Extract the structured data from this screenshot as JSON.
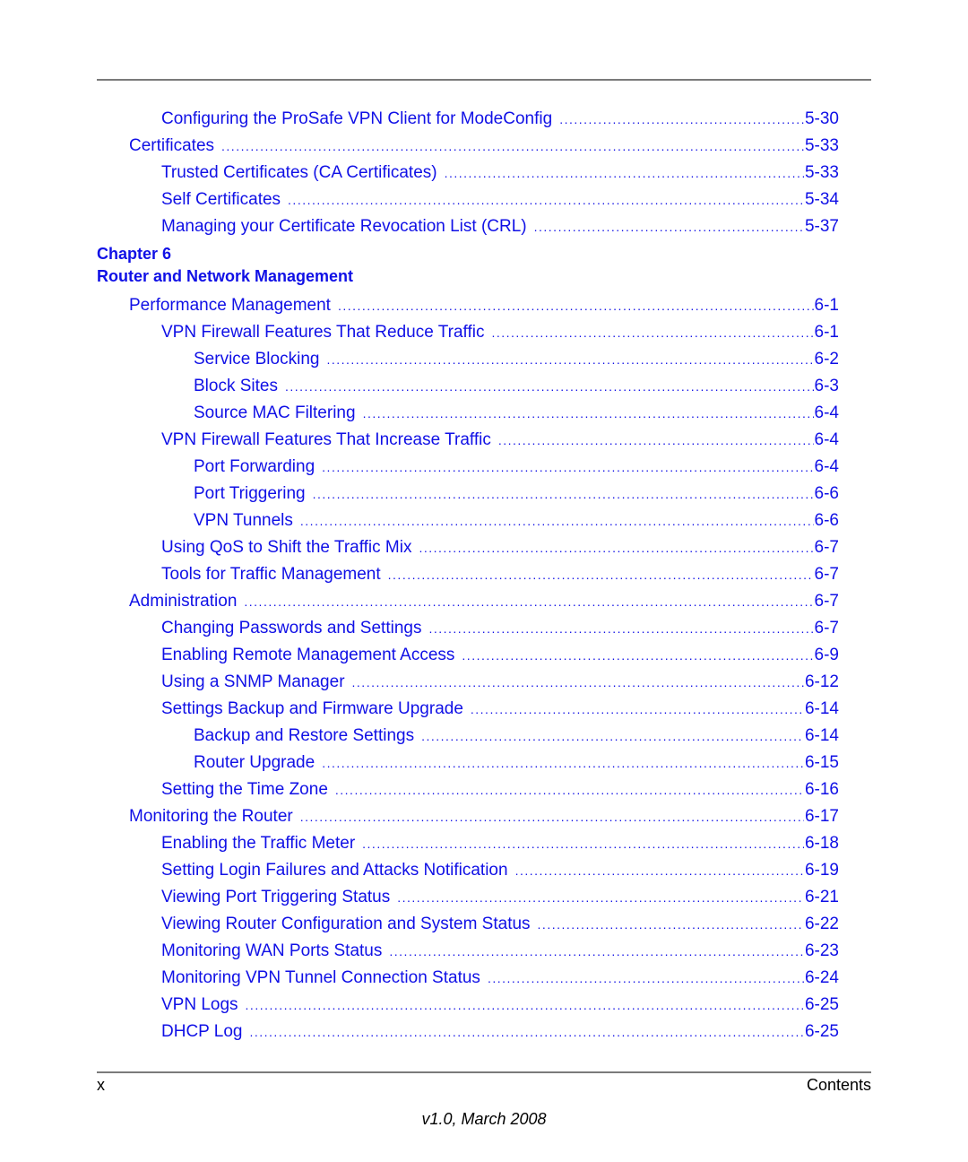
{
  "colors": {
    "link": "#1010e6",
    "rule": "#7a7a7a",
    "text": "#000000"
  },
  "toc_before": [
    {
      "level": 2,
      "title": "Configuring the ProSafe VPN Client for ModeConfig",
      "page": "5-30"
    },
    {
      "level": 1,
      "title": "Certificates",
      "page": "5-33"
    },
    {
      "level": 2,
      "title": "Trusted Certificates (CA Certificates)",
      "page": "5-33"
    },
    {
      "level": 2,
      "title": "Self Certificates",
      "page": "5-34"
    },
    {
      "level": 2,
      "title": "Managing your Certificate Revocation List (CRL)",
      "page": "5-37"
    }
  ],
  "chapter": {
    "number_label": "Chapter 6",
    "title": "Router and Network Management"
  },
  "toc_after": [
    {
      "level": 1,
      "title": "Performance Management",
      "page": "6-1"
    },
    {
      "level": 2,
      "title": "VPN Firewall Features That Reduce Traffic",
      "page": "6-1"
    },
    {
      "level": 3,
      "title": "Service Blocking",
      "page": "6-2"
    },
    {
      "level": 3,
      "title": "Block Sites",
      "page": "6-3"
    },
    {
      "level": 3,
      "title": "Source MAC Filtering",
      "page": "6-4"
    },
    {
      "level": 2,
      "title": "VPN Firewall Features That Increase Traffic",
      "page": "6-4"
    },
    {
      "level": 3,
      "title": "Port Forwarding",
      "page": "6-4"
    },
    {
      "level": 3,
      "title": "Port Triggering",
      "page": "6-6"
    },
    {
      "level": 3,
      "title": "VPN Tunnels",
      "page": "6-6"
    },
    {
      "level": 2,
      "title": "Using QoS to Shift the Traffic Mix",
      "page": "6-7"
    },
    {
      "level": 2,
      "title": "Tools for Traffic Management",
      "page": "6-7"
    },
    {
      "level": 1,
      "title": "Administration",
      "page": "6-7"
    },
    {
      "level": 2,
      "title": "Changing Passwords and Settings",
      "page": "6-7"
    },
    {
      "level": 2,
      "title": "Enabling Remote Management Access",
      "page": "6-9"
    },
    {
      "level": 2,
      "title": "Using a SNMP Manager",
      "page": "6-12"
    },
    {
      "level": 2,
      "title": "Settings Backup and Firmware Upgrade",
      "page": "6-14"
    },
    {
      "level": 3,
      "title": "Backup and Restore Settings",
      "page": "6-14"
    },
    {
      "level": 3,
      "title": "Router Upgrade",
      "page": "6-15"
    },
    {
      "level": 2,
      "title": "Setting the Time Zone",
      "page": "6-16"
    },
    {
      "level": 1,
      "title": "Monitoring the Router",
      "page": "6-17"
    },
    {
      "level": 2,
      "title": "Enabling the Traffic Meter",
      "page": "6-18"
    },
    {
      "level": 2,
      "title": "Setting Login Failures and Attacks Notification",
      "page": "6-19"
    },
    {
      "level": 2,
      "title": "Viewing Port Triggering Status",
      "page": "6-21"
    },
    {
      "level": 2,
      "title": "Viewing Router Configuration and System Status",
      "page": "6-22"
    },
    {
      "level": 2,
      "title": "Monitoring WAN Ports Status",
      "page": "6-23"
    },
    {
      "level": 2,
      "title": "Monitoring VPN Tunnel Connection Status",
      "page": "6-24"
    },
    {
      "level": 2,
      "title": "VPN Logs",
      "page": "6-25"
    },
    {
      "level": 2,
      "title": "DHCP Log",
      "page": "6-25"
    }
  ],
  "footer": {
    "page_number": "x",
    "section": "Contents",
    "version": "v1.0, March 2008"
  }
}
